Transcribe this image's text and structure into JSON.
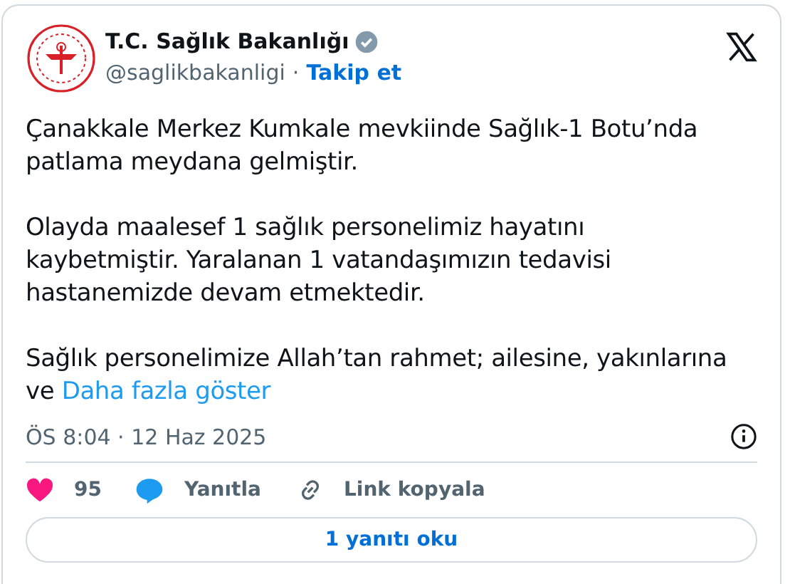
{
  "author": {
    "name": "T.C. Sağlık Bakanlığı",
    "verified": true,
    "handle": "@saglikbakanligi",
    "separator": "·",
    "follow": "Takip et"
  },
  "paragraphs": [
    {
      "lines": [
        "Çanakkale Merkez Kumkale mevkiinde Sağlık-1 Botu’nda",
        "patlama meydana gelmiştir."
      ]
    },
    {
      "lines": [
        "Olayda maalesef 1 sağlık personelimiz hayatını",
        "kaybetmiştir. Yaralanan 1 vatandaşımızın tedavisi",
        "hastanemizde devam etmektedir."
      ]
    },
    {
      "lines": [
        "Sağlık personelimize Allah’tan rahmet; ailesine, yakınlarına",
        "ve"
      ],
      "more": "Daha fazla göster"
    }
  ],
  "timestamp": "ÖS 8:04 · 12 Haz 2025",
  "actions": [
    {
      "kind": "like",
      "label": "95"
    },
    {
      "kind": "reply",
      "label": "Yanıtla"
    },
    {
      "kind": "link",
      "label": "Link kopyala"
    }
  ],
  "read_replies": "1 yanıtı oku"
}
